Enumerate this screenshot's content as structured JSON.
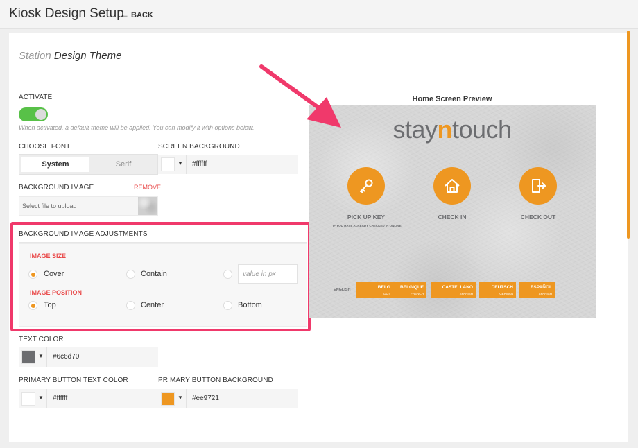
{
  "header": {
    "title": "Kiosk Design Setup",
    "back_label": "BACK"
  },
  "section": {
    "title_light": "Station",
    "title_dark": " Design Theme"
  },
  "activate": {
    "label": "ACTIVATE",
    "enabled": true,
    "hint": "When activated, a default theme will be applied. You can modify it with options below."
  },
  "font": {
    "label": "CHOOSE FONT",
    "options": [
      "System",
      "Serif"
    ],
    "selected": "System"
  },
  "screen_background": {
    "label": "SCREEN BACKGROUND",
    "value": "#ffffff"
  },
  "background_image": {
    "label": "BACKGROUND IMAGE",
    "remove_label": "REMOVE",
    "placeholder": "Select file to upload"
  },
  "adjustments": {
    "label": "BACKGROUND IMAGE ADJUSTMENTS",
    "size_label": "IMAGE SIZE",
    "size_options": [
      "Cover",
      "Contain"
    ],
    "size_selected": "Cover",
    "px_placeholder": "value in px",
    "position_label": "IMAGE POSITION",
    "position_options": [
      "Top",
      "Center",
      "Bottom"
    ],
    "position_selected": "Top"
  },
  "text_color": {
    "label": "TEXT COLOR",
    "value": "#6c6d70"
  },
  "primary_button_text_color": {
    "label": "PRIMARY BUTTON TEXT COLOR",
    "value": "#ffffff"
  },
  "primary_button_background": {
    "label": "PRIMARY BUTTON BACKGROUND",
    "value": "#ee9721"
  },
  "preview": {
    "title": "Home Screen Preview",
    "logo_pre": "stay",
    "logo_mid": "n",
    "logo_post": "touch",
    "actions": [
      {
        "label": "PICK UP KEY",
        "icon": "key-icon"
      },
      {
        "label": "CHECK IN",
        "icon": "house-icon"
      },
      {
        "label": "CHECK OUT",
        "icon": "door-exit-icon"
      }
    ],
    "pickup_note": "IF YOU HAVE ALREADY CHECKED IN ONLINE.",
    "current_language": "ENGLISH",
    "languages": [
      {
        "name": "BELGIË",
        "sub": "DUTCH"
      },
      {
        "name": "BELGIQUE",
        "sub": "FRENCH"
      },
      {
        "name": "CASTELLANO",
        "sub": "SPANISH"
      },
      {
        "name": "DEUTSCH",
        "sub": "GERMAN"
      },
      {
        "name": "ESPAÑOL",
        "sub": "SPANISH"
      }
    ]
  },
  "colors": {
    "accent": "#ee9721",
    "toggle_on": "#58c148",
    "highlight": "#f0396b",
    "danger": "#e94b4b",
    "text": "#6c6d70"
  }
}
